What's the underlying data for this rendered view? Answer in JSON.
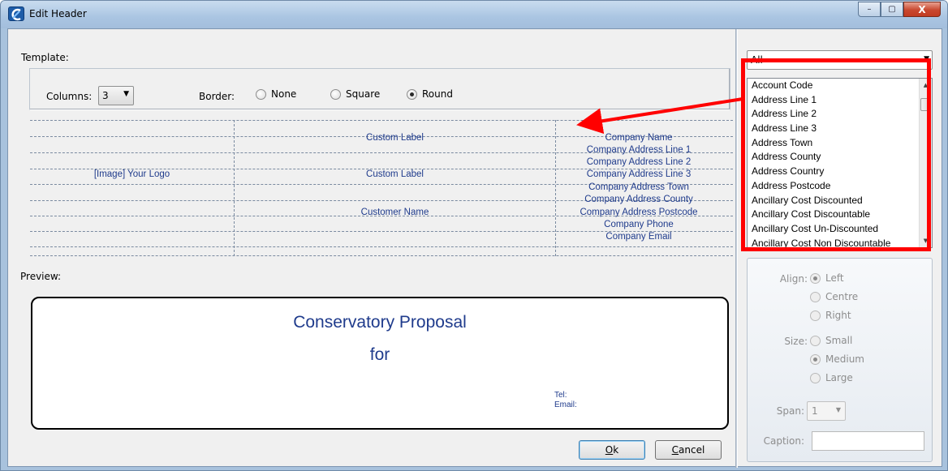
{
  "window": {
    "title": "Edit Header",
    "minimize": "–",
    "maximize": "▢",
    "close": "X"
  },
  "template": {
    "label": "Template:",
    "columns_label": "Columns:",
    "columns_value": "3",
    "border_label": "Border:",
    "border_options": [
      "None",
      "Square",
      "Round"
    ],
    "border_selected": "Round",
    "grid": {
      "col1": [
        "[Image] Your Logo"
      ],
      "col2": [
        "Custom Label",
        "Custom Label",
        "Customer Name"
      ],
      "col3": [
        "Company Name",
        "Company Address Line 1",
        "Company Address Line 2",
        "Company Address Line 3",
        "Company Address Town",
        "Company Address County",
        "Company Address Postcode",
        "Company Phone",
        "Company Email"
      ]
    }
  },
  "preview": {
    "label": "Preview:",
    "title": "Conservatory Proposal",
    "subtitle": "for",
    "tel": "Tel:",
    "email": "Email:"
  },
  "buttons": {
    "ok_key": "O",
    "ok_rest": "k",
    "cancel_key": "C",
    "cancel_rest": "ancel"
  },
  "fields": {
    "filter_value": "All",
    "items": [
      "Account Code",
      "Address Line 1",
      "Address Line 2",
      "Address Line 3",
      "Address Town",
      "Address County",
      "Address Country",
      "Address Postcode",
      "Ancillary Cost Discounted",
      "Ancillary Cost Discountable",
      "Ancillary Cost Un-Discounted",
      "Ancillary Cost Non Discountable"
    ]
  },
  "properties": {
    "align_label": "Align:",
    "align_options": [
      "Left",
      "Centre",
      "Right"
    ],
    "align_selected": "Left",
    "size_label": "Size:",
    "size_options": [
      "Small",
      "Medium",
      "Large"
    ],
    "size_selected": "Medium",
    "span_label": "Span:",
    "span_value": "1",
    "caption_label": "Caption:",
    "caption_value": ""
  },
  "colors": {
    "annotation": "#ff0000",
    "template_text": "#1f3b8c"
  }
}
